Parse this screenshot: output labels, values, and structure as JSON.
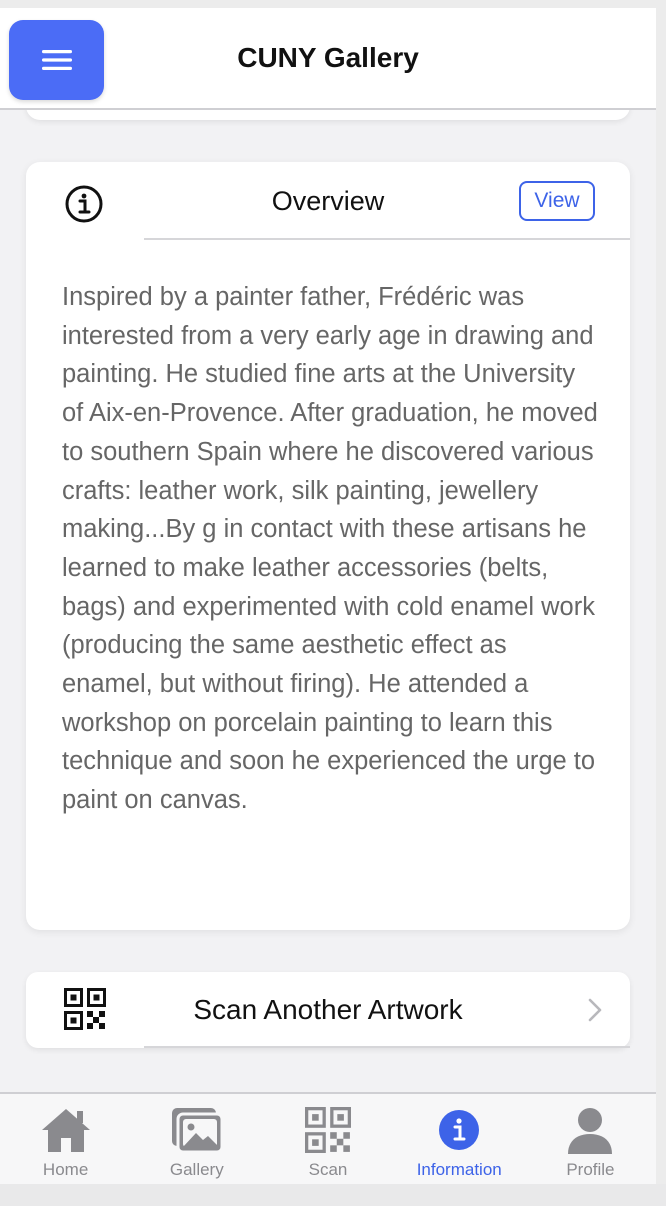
{
  "header": {
    "title": "CUNY Gallery",
    "menu_icon": "hamburger-menu-icon",
    "accent_color": "#4b6cf6"
  },
  "overview": {
    "icon": "info-icon",
    "title": "Overview",
    "view_label": "View",
    "text": "Inspired by a painter father, Frédéric was interested from a very early age in drawing and painting. He studied fine arts at the University of Aix-en-Provence. After graduation, he moved to southern Spain where he discovered various crafts: leather work, silk painting, jewellery making...By g in contact with these artisans he learned to make leather accessories (belts, bags) and experimented with cold enamel work (producing the same aesthetic effect as enamel, but without firing). He attended a workshop on porcelain painting to learn this technique and soon he experienced the urge to paint on canvas."
  },
  "scan_card": {
    "icon": "qr-code-icon",
    "label": "Scan Another Artwork",
    "chevron_icon": "chevron-right-icon"
  },
  "tabbar": {
    "active_color": "#3d63e8",
    "tabs": [
      {
        "label": "Home",
        "icon": "home-icon"
      },
      {
        "label": "Gallery",
        "icon": "gallery-icon"
      },
      {
        "label": "Scan",
        "icon": "qr-code-icon"
      },
      {
        "label": "Information",
        "icon": "info-icon",
        "active": true
      },
      {
        "label": "Profile",
        "icon": "profile-icon"
      }
    ]
  }
}
